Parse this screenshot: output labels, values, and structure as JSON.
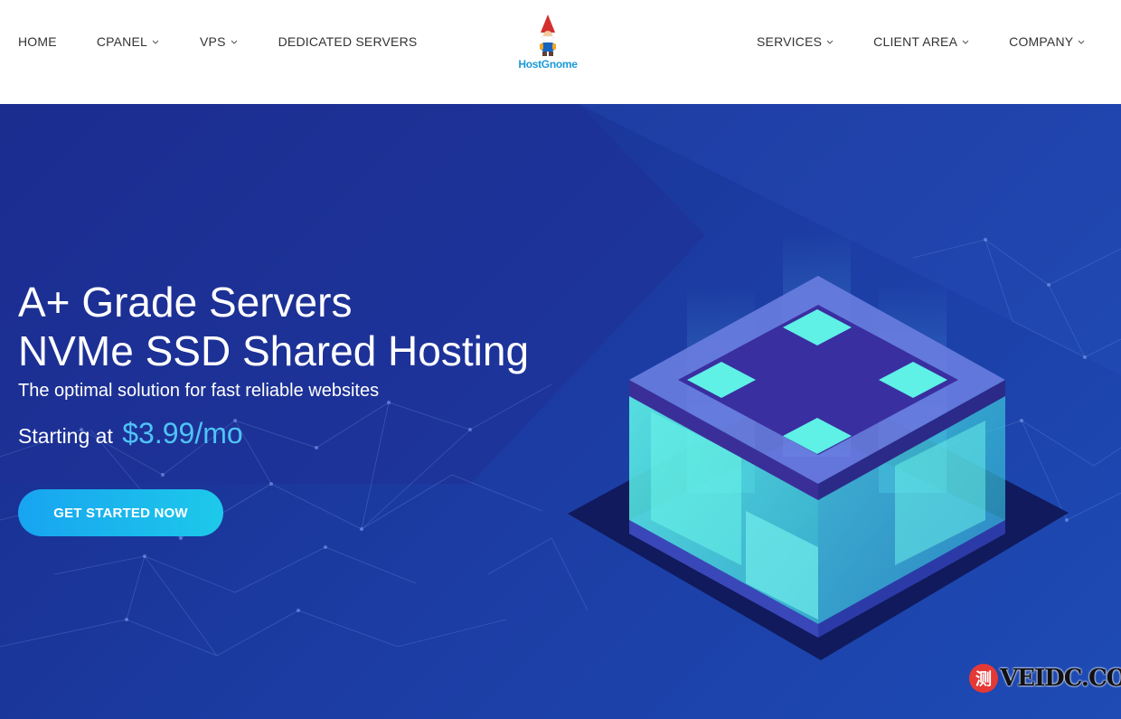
{
  "header": {
    "nav_left": [
      {
        "label": "HOME",
        "has_dropdown": false
      },
      {
        "label": "CPANEL",
        "has_dropdown": true
      },
      {
        "label": "VPS",
        "has_dropdown": true
      },
      {
        "label": "DEDICATED SERVERS",
        "has_dropdown": false
      }
    ],
    "logo_text": "HostGnome",
    "nav_right": [
      {
        "label": "SERVICES",
        "has_dropdown": true
      },
      {
        "label": "CLIENT AREA",
        "has_dropdown": true
      },
      {
        "label": "COMPANY",
        "has_dropdown": true
      }
    ]
  },
  "hero": {
    "title_line1": "A+ Grade Servers",
    "title_line2": "NVMe SSD Shared Hosting",
    "subtitle": "The optimal solution for fast reliable websites",
    "price_prefix": "Starting at",
    "price": "$3.99/mo",
    "cta_label": "GET STARTED NOW"
  },
  "watermark": {
    "badge": "测",
    "text": "VEIDC.COM"
  },
  "colors": {
    "hero_bg": "#1b3aa0",
    "price_accent": "#4fc3f7",
    "cta_start": "#18a4f0",
    "cta_end": "#1dc9ea",
    "cube_glow": "#4ee8e0",
    "logo_text": "#1a9ad6"
  },
  "icons": {
    "chevron": "chevron-down-icon",
    "logo": "gnome-logo-icon"
  }
}
